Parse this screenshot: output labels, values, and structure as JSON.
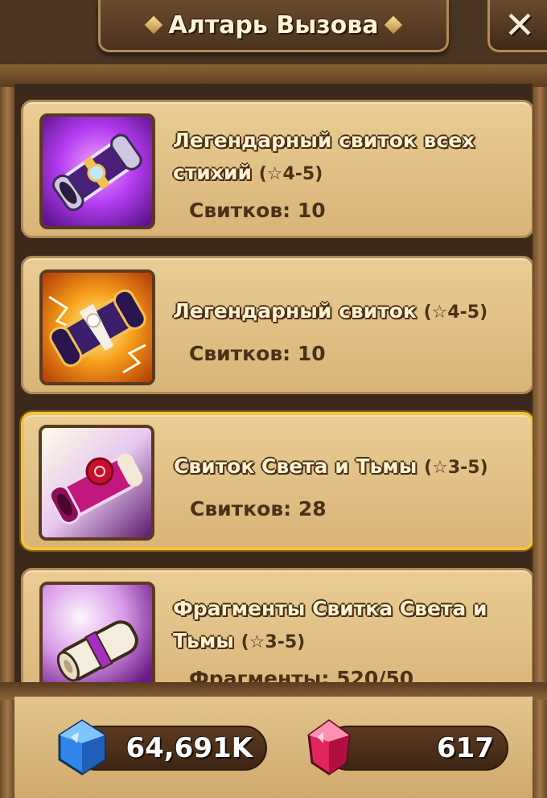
{
  "header": {
    "title": "Алтарь Вызова",
    "close_label": "✕"
  },
  "cards": [
    {
      "name": "Легендарный свиток всех стихий",
      "stars": "(☆4-5)",
      "count_label": "Свитков: 10",
      "icon": "legendary-all-elements-scroll-icon"
    },
    {
      "name": "Легендарный свиток",
      "stars": "(☆4-5)",
      "count_label": "Свитков: 10",
      "icon": "legendary-scroll-icon"
    },
    {
      "name": "Свиток Света и Тьмы",
      "stars": "(☆3-5)",
      "count_label": "Свитков: 28",
      "icon": "light-dark-scroll-icon",
      "selected": true
    },
    {
      "name": "Фрагменты Свитка Света и Тьмы",
      "stars": "(☆3-5)",
      "count_label": "Фрагменты: 520/50",
      "icon": "light-dark-fragments-icon"
    }
  ],
  "currency": {
    "crystals": "64,691K",
    "crystals_icon": "blue-crystal-icon",
    "gems": "617",
    "gems_icon": "red-gem-icon"
  },
  "colors": {
    "card_bg": "#e3c48b",
    "selected_border": "#f3c43b",
    "frame": "#4a3522"
  }
}
